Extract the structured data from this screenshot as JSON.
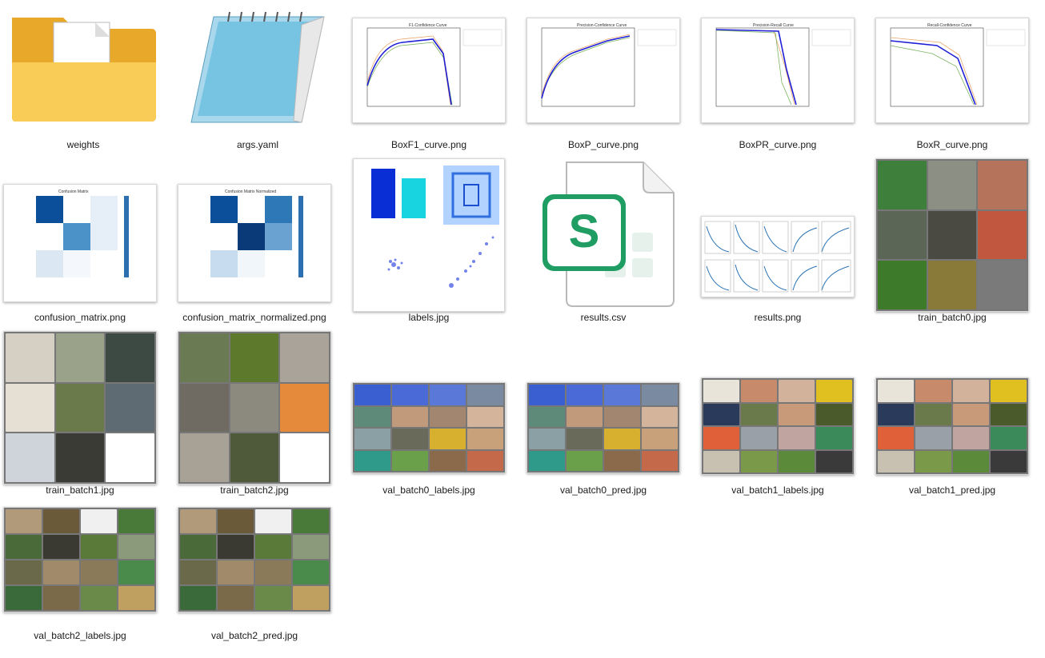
{
  "files": [
    {
      "name": "weights"
    },
    {
      "name": "args.yaml"
    },
    {
      "name": "BoxF1_curve.png"
    },
    {
      "name": "BoxP_curve.png"
    },
    {
      "name": "BoxPR_curve.png"
    },
    {
      "name": "BoxR_curve.png"
    },
    {
      "name": "confusion_matrix.png"
    },
    {
      "name": "confusion_matrix_normalized.png"
    },
    {
      "name": "labels.jpg"
    },
    {
      "name": "results.csv"
    },
    {
      "name": "results.png"
    },
    {
      "name": "train_batch0.jpg"
    },
    {
      "name": "train_batch1.jpg"
    },
    {
      "name": "train_batch2.jpg"
    },
    {
      "name": "val_batch0_labels.jpg"
    },
    {
      "name": "val_batch0_pred.jpg"
    },
    {
      "name": "val_batch1_labels.jpg"
    },
    {
      "name": "val_batch1_pred.jpg"
    },
    {
      "name": "val_batch2_labels.jpg"
    },
    {
      "name": "val_batch2_pred.jpg"
    }
  ],
  "thumb_titles": {
    "f1": "F1-Confidence Curve",
    "p": "Precision-Confidence Curve",
    "pr": "Precision-Recall Curve",
    "r": "Recall-Confidence Curve",
    "cm": "Confusion Matrix",
    "cmn": "Confusion Matrix Normalized"
  },
  "colors": {
    "folder": "#f6c443",
    "spreadsheet": "#1f9d63",
    "curve_main": "#1f1fd6",
    "accent_box": "#2fb5ff"
  },
  "icons": {
    "folder": "folder-icon",
    "notepad": "notepad-icon",
    "spreadsheet": "spreadsheet-icon"
  }
}
